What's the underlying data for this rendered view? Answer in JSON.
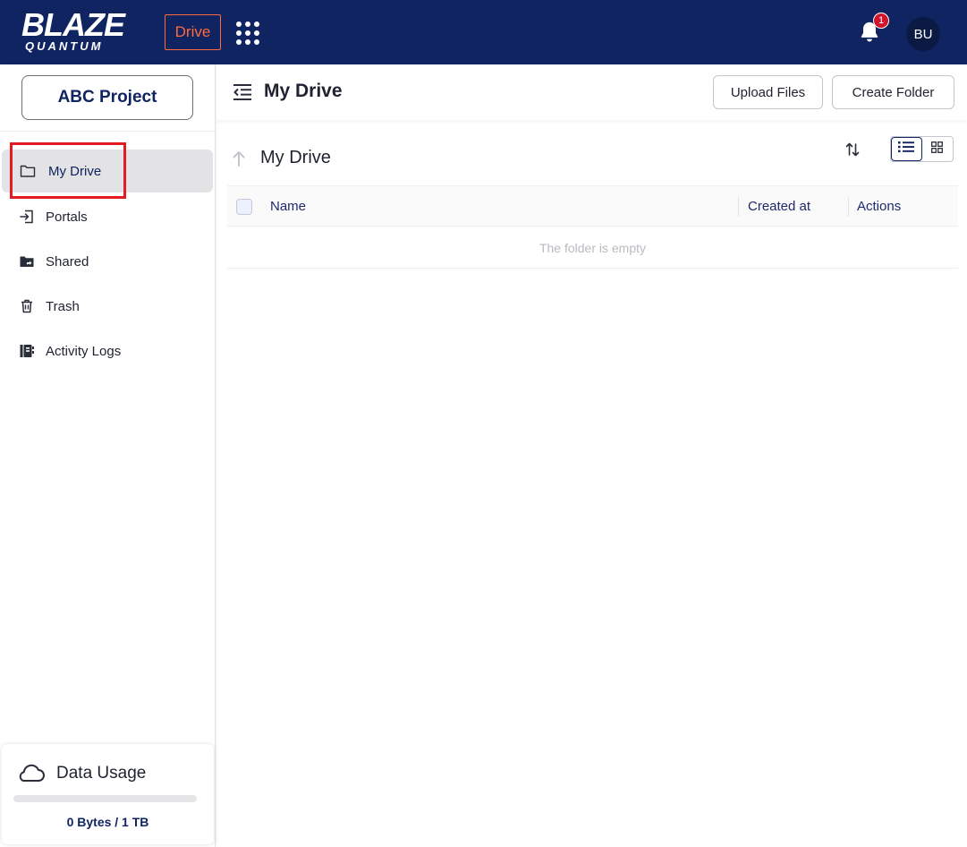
{
  "topbar": {
    "logo_main": "BLAZE",
    "logo_sub": "QUANTUM",
    "app_chip": "Drive",
    "notification_count": "1",
    "avatar_initials": "BU",
    "colors": {
      "background": "#0f2461",
      "accent": "#ff6b3d",
      "badge": "#d0142c"
    }
  },
  "sidebar": {
    "project_button": "ABC Project",
    "items": [
      {
        "label": "My Drive",
        "icon": "folder-icon",
        "active": true
      },
      {
        "label": "Portals",
        "icon": "portal-enter-icon",
        "active": false
      },
      {
        "label": "Shared",
        "icon": "shared-folder-icon",
        "active": false
      },
      {
        "label": "Trash",
        "icon": "trash-icon",
        "active": false
      },
      {
        "label": "Activity Logs",
        "icon": "activity-log-icon",
        "active": false
      }
    ],
    "usage": {
      "title": "Data Usage",
      "icon": "cloud-icon",
      "text": "0 Bytes / 1 TB",
      "fraction": 0
    }
  },
  "header": {
    "title": "My Drive",
    "upload_label": "Upload Files",
    "create_label": "Create Folder"
  },
  "content": {
    "title": "My Drive",
    "table": {
      "columns": [
        "Name",
        "Created at",
        "Actions"
      ],
      "empty_message": "The folder is empty"
    },
    "view_mode": "list"
  }
}
